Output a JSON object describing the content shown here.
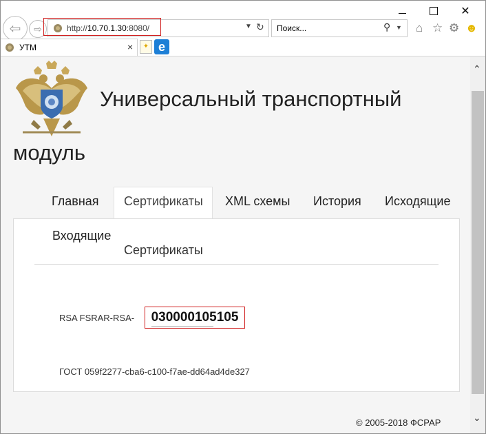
{
  "browser": {
    "url_prefix": "http://",
    "url_host": "10.70.1.30",
    "url_port": ":8080/",
    "search_placeholder": "Поиск...",
    "tab_title": "УТМ",
    "tab_close": "×"
  },
  "page": {
    "title_line1": "Универсальный транспортный",
    "title_line2": "модуль",
    "nav": [
      "Главная",
      "Сертификаты",
      "XML схемы",
      "История",
      "Исходящие"
    ],
    "nav_second_row": "Входящие",
    "section_title": "Сертификаты",
    "rsa_label": "RSA FSRAR-RSA-",
    "rsa_value": "030000105105",
    "gost_label": "ГОСТ 059f2277-cba6-c100-f7ae-dd64ad4de327",
    "footer": "© 2005-2018 ФСРАР"
  },
  "colors": {
    "highlight": "#d01f1f",
    "ie_blue": "#1d7fd6"
  },
  "icons": [
    "back-icon",
    "forward-icon",
    "refresh-icon",
    "search-icon",
    "home-icon",
    "favorites-icon",
    "settings-icon",
    "smiley-icon",
    "new-tab-icon",
    "ie-icon",
    "eagle-emblem-icon"
  ]
}
